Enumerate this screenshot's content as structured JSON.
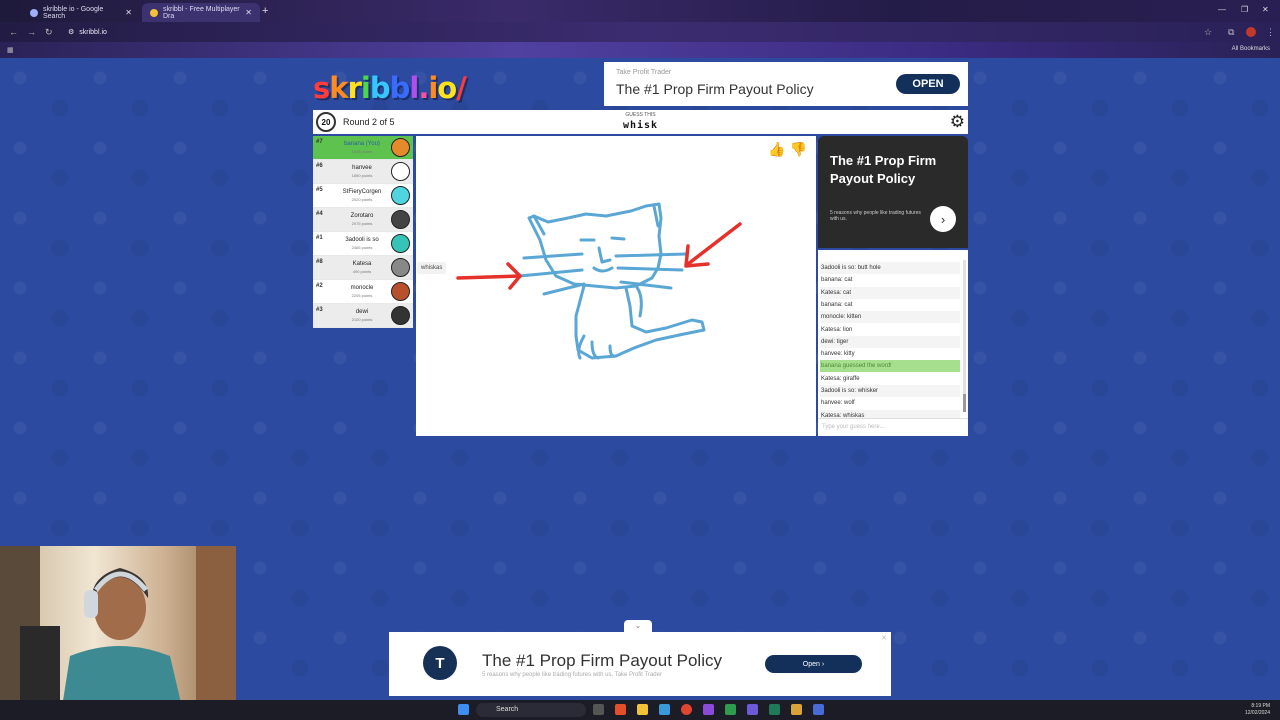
{
  "browser": {
    "tabs": [
      {
        "label": "skribble io - Google Search"
      },
      {
        "label": "skribbl - Free Multiplayer Dra"
      }
    ],
    "url": "skribbl.io",
    "all_bookmarks": "All Bookmarks"
  },
  "logo": {
    "text": "skribbl.io/"
  },
  "top_ad": {
    "small": "Take Profit Trader",
    "headline": "The #1 Prop Firm Payout Policy",
    "button": "OPEN"
  },
  "game": {
    "timer": "20",
    "round": "Round 2 of 5",
    "guess_label": "GUESS THIS",
    "word": "whisk"
  },
  "players": [
    {
      "rank": "#7",
      "name": "banana (You)",
      "points": "1635 points",
      "avatar_color": "#e58a2a",
      "me": true
    },
    {
      "rank": "#6",
      "name": "hanvee",
      "points": "1650 points",
      "avatar_color": "#ffffff"
    },
    {
      "rank": "#5",
      "name": "StFieryCorgen",
      "points": "2020 points",
      "avatar_color": "#4fd4e0"
    },
    {
      "rank": "#4",
      "name": "Zorotaro",
      "points": "2075 points",
      "avatar_color": "#444444"
    },
    {
      "rank": "#1",
      "name": "3adooli is so",
      "points": "2465 points",
      "avatar_color": "#37c4b8"
    },
    {
      "rank": "#8",
      "name": "Katesa",
      "points": "490 points",
      "avatar_color": "#888888"
    },
    {
      "rank": "#2",
      "name": "monocle",
      "points": "2205 points",
      "avatar_color": "#b8502c"
    },
    {
      "rank": "#3",
      "name": "dewi",
      "points": "2100 points",
      "avatar_color": "#333333"
    }
  ],
  "drawing_hint": "whiskas",
  "side_ad": {
    "title": "The #1 Prop Firm Payout Policy",
    "subtitle": "5 reasons why people like trading futures with us."
  },
  "chat": {
    "messages": [
      {
        "text": "3adooli is so: butt hole"
      },
      {
        "text": "banana: cat"
      },
      {
        "text": "Katesa: cat"
      },
      {
        "text": "banana: cat"
      },
      {
        "text": "monocle: kitten"
      },
      {
        "text": "Katesa: lion"
      },
      {
        "text": "dewi: tiger"
      },
      {
        "text": "hanvee: kitty"
      },
      {
        "text": "banana guessed the word!",
        "ok": true
      },
      {
        "text": "Katesa: giraffe"
      },
      {
        "text": "3adooli is so: whisker"
      },
      {
        "text": "hanvee: wolf"
      },
      {
        "text": "Katesa: whiskas"
      }
    ],
    "input_placeholder": "Type your guess here..."
  },
  "bottom_ad": {
    "headline": "The #1 Prop Firm Payout Policy",
    "subtitle": "5 reasons why people like trading futures with us. Take Profit Trader",
    "button": "Open"
  },
  "taskbar": {
    "search": "Search",
    "time": "8:19 PM",
    "date": "12/02/2024"
  }
}
